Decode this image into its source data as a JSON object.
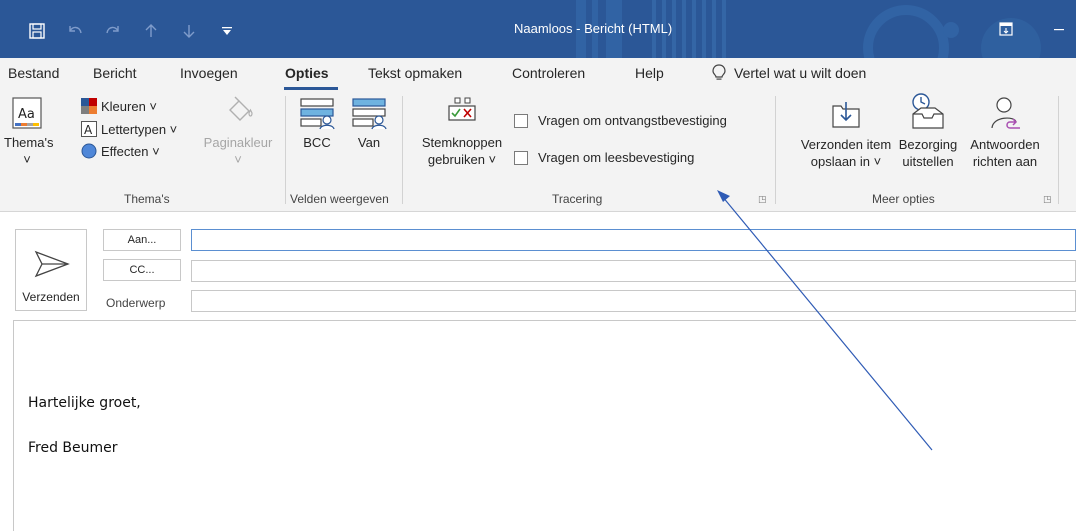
{
  "window": {
    "title": "Naamloos  -  Bericht (HTML)",
    "colors": {
      "titlebar": "#2b5797",
      "ribbon": "#f3f3f3",
      "accent": "#2b5797"
    }
  },
  "quick_access": [
    "save-icon",
    "undo-icon",
    "redo-icon",
    "up-icon",
    "down-icon",
    "customize-icon"
  ],
  "tabs": [
    {
      "label": "Bestand"
    },
    {
      "label": "Bericht"
    },
    {
      "label": "Invoegen"
    },
    {
      "label": "Opties",
      "active": true
    },
    {
      "label": "Tekst opmaken"
    },
    {
      "label": "Controleren"
    },
    {
      "label": "Help"
    }
  ],
  "tell_me": "Vertel wat u wilt doen",
  "ribbon": {
    "themes": {
      "group_label": "Thema's",
      "themes_label": "Thema's",
      "themes_chevron": "˅",
      "colors_label": "Kleuren ˅",
      "fonts_label": "Lettertypen ˅",
      "effects_label": "Effecten ˅",
      "page_color_label": "Paginakleur",
      "page_color_chevron": "˅"
    },
    "fields": {
      "group_label": "Velden weergeven",
      "bcc_label": "BCC",
      "from_label": "Van"
    },
    "tracking": {
      "group_label": "Tracering",
      "voting_label_1": "Stemknoppen",
      "voting_label_2": "gebruiken ˅",
      "delivery_receipt_label": "Vragen om ontvangstbevestiging",
      "read_receipt_label": "Vragen om leesbevestiging"
    },
    "more_options": {
      "group_label": "Meer opties",
      "save_sent_1": "Verzonden item",
      "save_sent_2": "opslaan in ˅",
      "delay_1": "Bezorging",
      "delay_2": "uitstellen",
      "direct_1": "Antwoorden",
      "direct_2": "richten aan"
    }
  },
  "compose": {
    "send_label": "Verzenden",
    "to_label": "Aan...",
    "cc_label": "CC...",
    "subject_label": "Onderwerp",
    "to_value": "",
    "cc_value": "",
    "subject_value": "",
    "body_lines": [
      "Hartelijke groet,",
      "Fred Beumer"
    ]
  }
}
